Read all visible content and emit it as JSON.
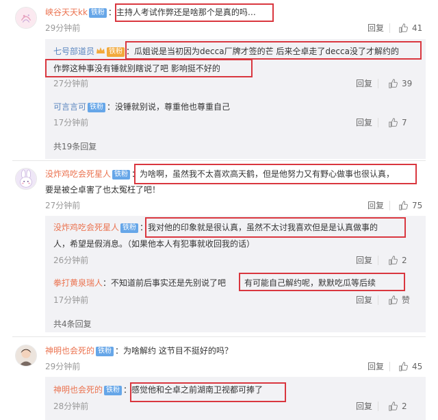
{
  "common": {
    "reply_label": "回复",
    "badge": "铁粉",
    "badge_gold": "铁粉"
  },
  "c1": {
    "user": "峡谷天天kk",
    "text": "主持人考试作弊还是啥那个是真的吗…",
    "time": "29分钟前",
    "likes": "41",
    "replies": [
      {
        "user": "七号部道员",
        "text1": "瓜姐说是当初因为decca厂牌才签的芒 后来仝卓走了decca没了才解约的",
        "text2": "作弊这种事没有锤就别瞎说了吧 影响挺不好的",
        "time": "27分钟前",
        "likes": "39"
      },
      {
        "user": "可言言可",
        "text": "没锤就别说，尊重他也尊重自己",
        "time": "17分钟前",
        "likes": "7"
      }
    ],
    "more": "共19条回复"
  },
  "c2": {
    "user": "没炸鸡吃会死星人",
    "text1": "为啥啊，虽然我不太喜欢高天鹤，但是他努力又有野心做事也很认真，",
    "text2": "要是被仝卓害了也太冤枉了吧！",
    "time": "27分钟前",
    "likes": "75",
    "replies": [
      {
        "user": "没炸鸡吃会死星人",
        "text1": "我对他的印象就是很认真，虽然不太讨我喜欢但是是认真做事的",
        "text2": "人，希望是假消息。（如果他本人有犯事就收回我的话）",
        "time": "26分钟前",
        "likes": "2"
      },
      {
        "user": "拳打黄泉瑞人",
        "text_a": "不知道前后事实还是先别说了吧",
        "text_b": "有可能自己解约呢，默默吃瓜等后续",
        "time": "17分钟前",
        "likes": "赞"
      }
    ],
    "more": "共4条回复"
  },
  "c3": {
    "user": "神明也会死的",
    "text": "为啥解约 这节目不挺好的吗？",
    "time": "29分钟前",
    "likes": "45",
    "replies": [
      {
        "user": "神明也会死的",
        "text": "感觉他和仝卓之前湖南卫视都可捧了",
        "time": "28分钟前",
        "likes": "2"
      }
    ]
  }
}
